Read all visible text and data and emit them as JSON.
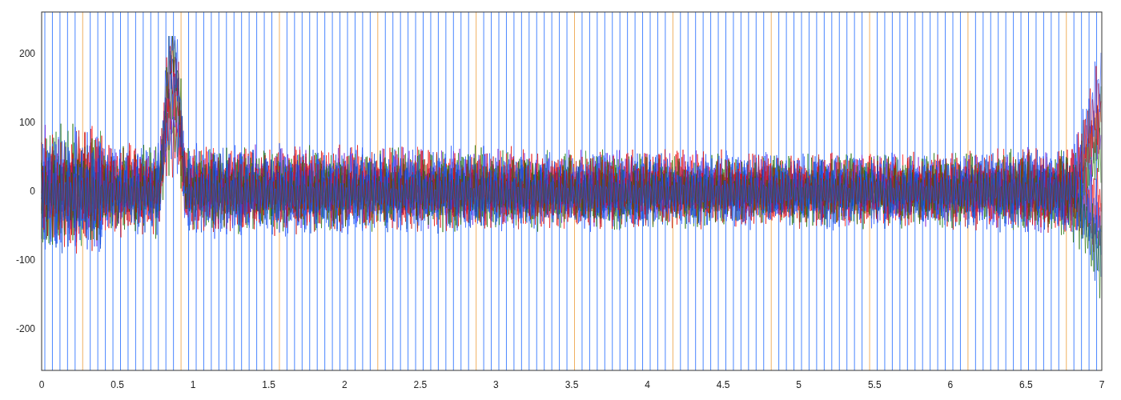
{
  "plot": {
    "y_ticks": [
      "200",
      "100",
      "0",
      "-100",
      "-200"
    ],
    "x_ticks": [
      "0",
      "0.5",
      "1",
      "1.5",
      "2",
      "2.5",
      "3",
      "3.5",
      "4",
      "4.5",
      "5",
      "5.5",
      "6",
      "6.5",
      "7"
    ]
  }
}
